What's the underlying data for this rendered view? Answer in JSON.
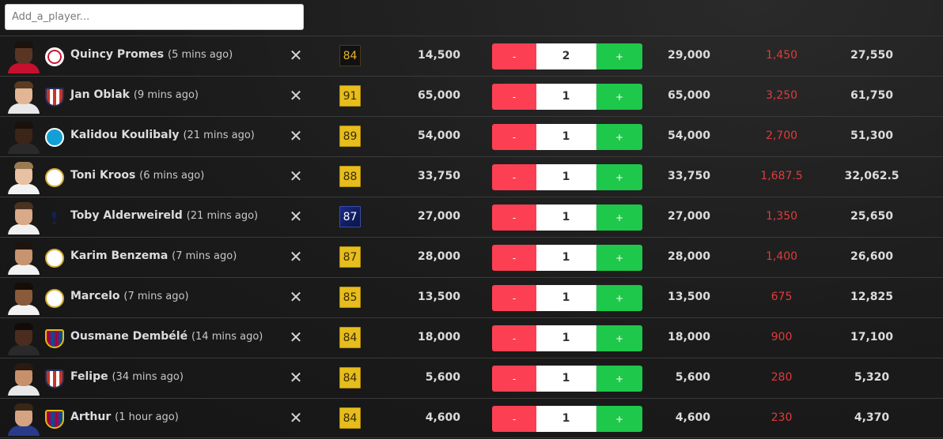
{
  "search": {
    "placeholder": "Add_a_player..."
  },
  "players": [
    {
      "name": "Quincy Promes",
      "ago": "(5 mins ago)",
      "rating": "84",
      "rating_style": "black",
      "price": "14,500",
      "qty": "2",
      "total": "29,000",
      "tax": "1,450",
      "profit": "27,550",
      "skin": "#5a3524",
      "hair": "#1a120c",
      "shirt": "#c8102e",
      "crest": "ajax-crest-icon"
    },
    {
      "name": "Jan Oblak",
      "ago": "(9 mins ago)",
      "rating": "91",
      "rating_style": "gold",
      "price": "65,000",
      "qty": "1",
      "total": "65,000",
      "tax": "3,250",
      "profit": "61,750",
      "skin": "#e2b594",
      "hair": "#5b3b22",
      "shirt": "#e8e8e8",
      "crest": "atletico-crest-icon"
    },
    {
      "name": "Kalidou Koulibaly",
      "ago": "(21 mins ago)",
      "rating": "89",
      "rating_style": "gold",
      "price": "54,000",
      "qty": "1",
      "total": "54,000",
      "tax": "2,700",
      "profit": "51,300",
      "skin": "#3b2418",
      "hair": "#1a110a",
      "shirt": "#2a2a2a",
      "crest": "napoli-crest-icon"
    },
    {
      "name": "Toni Kroos",
      "ago": "(6 mins ago)",
      "rating": "88",
      "rating_style": "gold",
      "price": "33,750",
      "qty": "1",
      "total": "33,750",
      "tax": "1,687.5",
      "profit": "32,062.5",
      "skin": "#e8c0a2",
      "hair": "#9a7a52",
      "shirt": "#f2f2f2",
      "crest": "real-madrid-crest-icon"
    },
    {
      "name": "Toby Alderweireld",
      "ago": "(21 mins ago)",
      "rating": "87",
      "rating_style": "blue",
      "price": "27,000",
      "qty": "1",
      "total": "27,000",
      "tax": "1,350",
      "profit": "25,650",
      "skin": "#d9a988",
      "hair": "#4a3220",
      "shirt": "#f0f0f0",
      "crest": "tottenham-crest-icon"
    },
    {
      "name": "Karim Benzema",
      "ago": "(7 mins ago)",
      "rating": "87",
      "rating_style": "gold",
      "price": "28,000",
      "qty": "1",
      "total": "28,000",
      "tax": "1,400",
      "profit": "26,600",
      "skin": "#c6946e",
      "hair": "#1e140e",
      "shirt": "#f2f2f2",
      "crest": "real-madrid-crest-icon"
    },
    {
      "name": "Marcelo",
      "ago": "(7 mins ago)",
      "rating": "85",
      "rating_style": "gold",
      "price": "13,500",
      "qty": "1",
      "total": "13,500",
      "tax": "675",
      "profit": "12,825",
      "skin": "#8a5a3c",
      "hair": "#140d08",
      "shirt": "#f2f2f2",
      "crest": "real-madrid-crest-icon"
    },
    {
      "name": "Ousmane Dembélé",
      "ago": "(14 mins ago)",
      "rating": "84",
      "rating_style": "gold",
      "price": "18,000",
      "qty": "1",
      "total": "18,000",
      "tax": "900",
      "profit": "17,100",
      "skin": "#4a2d1e",
      "hair": "#120b07",
      "shirt": "#2a2a2a",
      "crest": "barcelona-crest-icon"
    },
    {
      "name": "Felipe",
      "ago": "(34 mins ago)",
      "rating": "84",
      "rating_style": "gold",
      "price": "5,600",
      "qty": "1",
      "total": "5,600",
      "tax": "280",
      "profit": "5,320",
      "skin": "#c8906a",
      "hair": "#2a1a10",
      "shirt": "#e8e8e8",
      "crest": "atletico-crest-icon"
    },
    {
      "name": "Arthur",
      "ago": "(1 hour ago)",
      "rating": "84",
      "rating_style": "gold",
      "price": "4,600",
      "qty": "1",
      "total": "4,600",
      "tax": "230",
      "profit": "4,370",
      "skin": "#d4a482",
      "hair": "#3a2616",
      "shirt": "#2a3a8a",
      "crest": "barcelona-crest-icon"
    }
  ],
  "buttons": {
    "minus_label": "-",
    "plus_label": "+",
    "remove_label": "✕"
  },
  "colors": {
    "minus": "#fd3f53",
    "plus": "#1ec84a",
    "tax_text": "#e03b3b",
    "rating_gold": "#e6bd1c"
  }
}
